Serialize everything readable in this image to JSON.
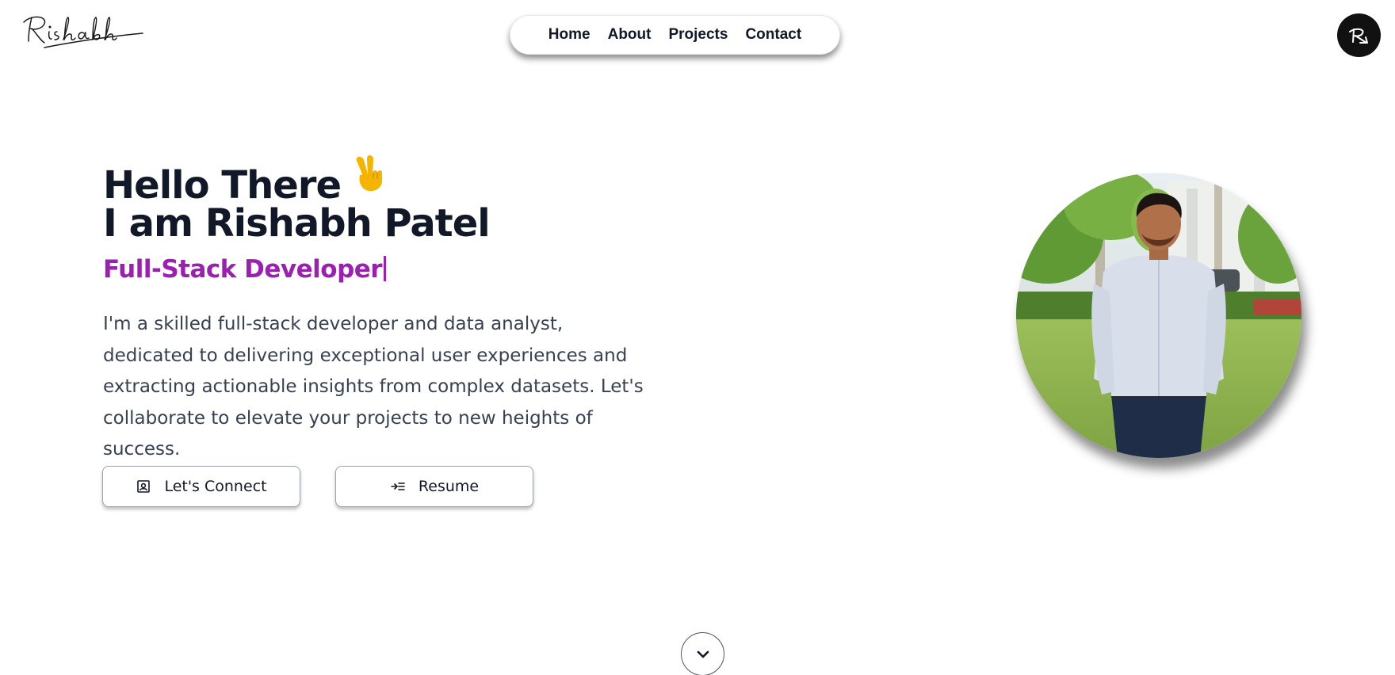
{
  "header": {
    "logo_text": "Rishabh",
    "nav": [
      {
        "label": "Home"
      },
      {
        "label": "About"
      },
      {
        "label": "Projects"
      },
      {
        "label": "Contact"
      }
    ],
    "theme_toggle_icon": "logo-arrow-icon"
  },
  "hero": {
    "greeting": "Hello There",
    "greeting_icon": "victory-hand-icon",
    "name": "I am Rishabh Patel",
    "role": "Full-Stack Developer",
    "bio": "I'm a skilled full-stack developer and data analyst, dedicated to delivering exceptional user experiences and extracting actionable insights from complex datasets. Let's collaborate to elevate your projects to new heights of success.",
    "buttons": [
      {
        "label": "Let's Connect",
        "icon": "contact-card-icon"
      },
      {
        "label": "Resume",
        "icon": "arrow-list-icon"
      }
    ]
  },
  "scroll": {
    "icon": "chevron-down-icon"
  },
  "colors": {
    "accent": "#9b1fb0",
    "text": "#111827",
    "muted": "#374151",
    "toggle_bg": "#111111",
    "emoji": "#f4b400"
  }
}
